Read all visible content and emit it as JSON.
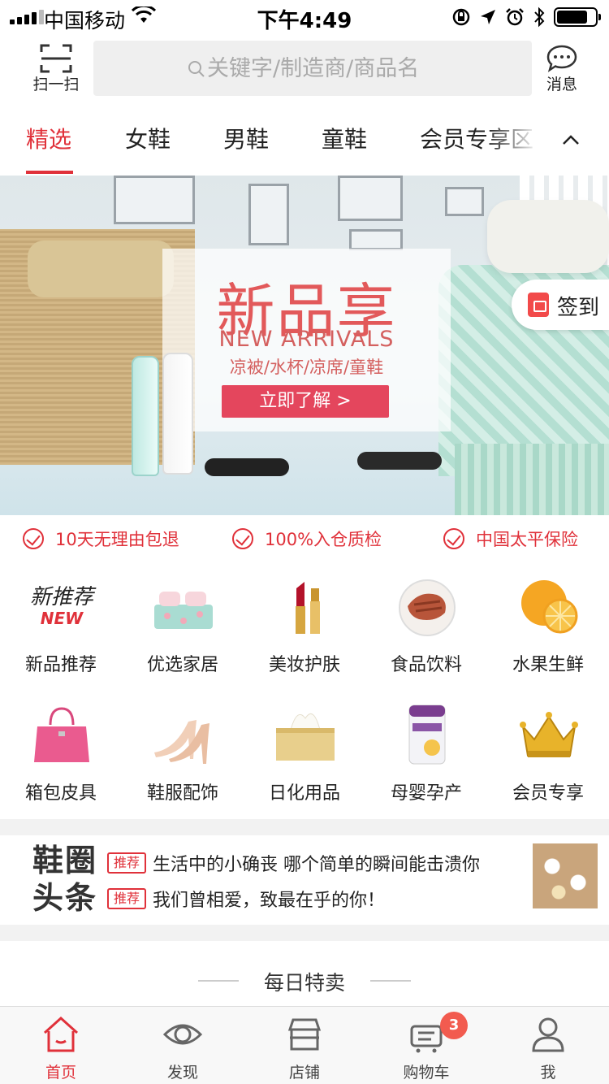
{
  "status_bar": {
    "carrier": "中国移动",
    "time": "下午4:49",
    "battery_level": 0.8
  },
  "header": {
    "scan_label": "扫一扫",
    "search_placeholder": "关键字/制造商/商品名",
    "message_label": "消息"
  },
  "tabs": [
    {
      "label": "精选",
      "active": true
    },
    {
      "label": "女鞋"
    },
    {
      "label": "男鞋"
    },
    {
      "label": "童鞋"
    },
    {
      "label": "会员专享区"
    }
  ],
  "banner": {
    "title": "新品享",
    "subtitle": "NEW ARRIVALS",
    "categories": "凉被/水杯/凉席/童鞋",
    "cta": "立即了解 >",
    "signin_label": "签到"
  },
  "guarantees": [
    "10天无理由包退",
    "100%入仓质检",
    "中国太平保险"
  ],
  "categories": [
    {
      "label": "新品推荐",
      "icon": "new-arrivals-icon",
      "logo_text": "新推荐",
      "logo_sub": "NEW"
    },
    {
      "label": "优选家居",
      "icon": "bedding-icon"
    },
    {
      "label": "美妆护肤",
      "icon": "lipstick-icon"
    },
    {
      "label": "食品饮料",
      "icon": "food-plate-icon"
    },
    {
      "label": "水果生鲜",
      "icon": "orange-fruit-icon"
    },
    {
      "label": "箱包皮具",
      "icon": "handbag-icon"
    },
    {
      "label": "鞋服配饰",
      "icon": "high-heels-icon"
    },
    {
      "label": "日化用品",
      "icon": "tissue-box-icon"
    },
    {
      "label": "母婴孕产",
      "icon": "milk-powder-can-icon"
    },
    {
      "label": "会员专享",
      "icon": "vip-crown-icon"
    }
  ],
  "headlines": {
    "logo_line1": "鞋圈",
    "logo_line2": "头条",
    "items": [
      {
        "tag": "推荐",
        "text": "生活中的小确丧 哪个简单的瞬间能击溃你"
      },
      {
        "tag": "推荐",
        "text": "我们曾相爱，致最在乎的你！"
      }
    ]
  },
  "daily": {
    "title": "每日特卖"
  },
  "bottom_nav": [
    {
      "label": "首页",
      "icon": "home-icon",
      "active": true
    },
    {
      "label": "发现",
      "icon": "eye-icon"
    },
    {
      "label": "店铺",
      "icon": "store-icon"
    },
    {
      "label": "购物车",
      "icon": "cart-icon",
      "badge": "3"
    },
    {
      "label": "我",
      "icon": "user-icon"
    }
  ],
  "colors": {
    "accent": "#e0313a",
    "banner_cta": "#e4465d",
    "badge": "#f25b4f"
  }
}
